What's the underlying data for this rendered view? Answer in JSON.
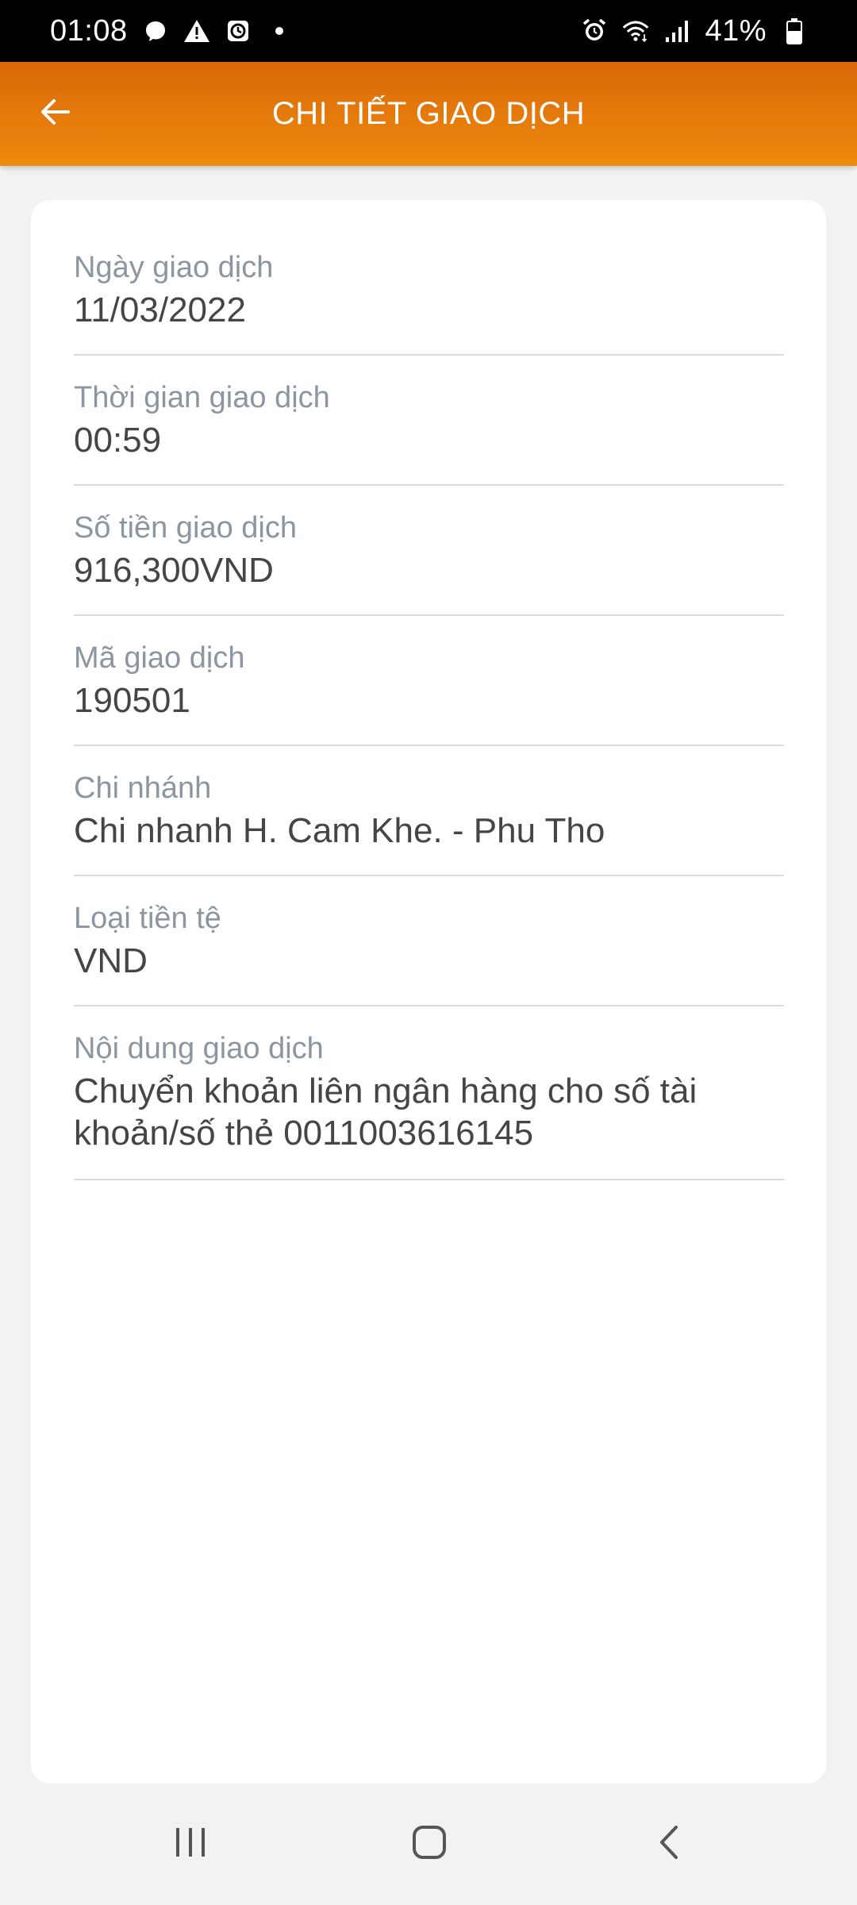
{
  "status_bar": {
    "time": "01:08",
    "battery": "41%",
    "left_icons": [
      "messenger-icon",
      "warning-icon",
      "clock-app-icon",
      "dot-icon"
    ],
    "right_icons": [
      "alarm-icon",
      "wifi-icon",
      "signal-icon",
      "battery-icon"
    ]
  },
  "header": {
    "title": "CHI TIẾT GIAO DỊCH",
    "back_icon": "arrow-left-icon",
    "bg_color_top": "#d9690a",
    "bg_color_bottom": "#ee8a0c"
  },
  "details": [
    {
      "label": "Ngày giao dịch",
      "value": "11/03/2022"
    },
    {
      "label": "Thời gian giao dịch",
      "value": "00:59"
    },
    {
      "label": "Số tiền giao dịch",
      "value": "916,300VND"
    },
    {
      "label": "Mã giao dịch",
      "value": "190501"
    },
    {
      "label": "Chi nhánh",
      "value": "Chi nhanh H. Cam Khe. - Phu Tho"
    },
    {
      "label": "Loại tiền tệ",
      "value": "VND"
    },
    {
      "label": "Nội dung giao dịch",
      "value": "Chuyển khoản liên ngân hàng cho số tài khoản/số thẻ 0011003616145"
    }
  ],
  "nav_bar": {
    "icons": [
      "recent-apps-icon",
      "home-icon",
      "back-icon"
    ]
  }
}
